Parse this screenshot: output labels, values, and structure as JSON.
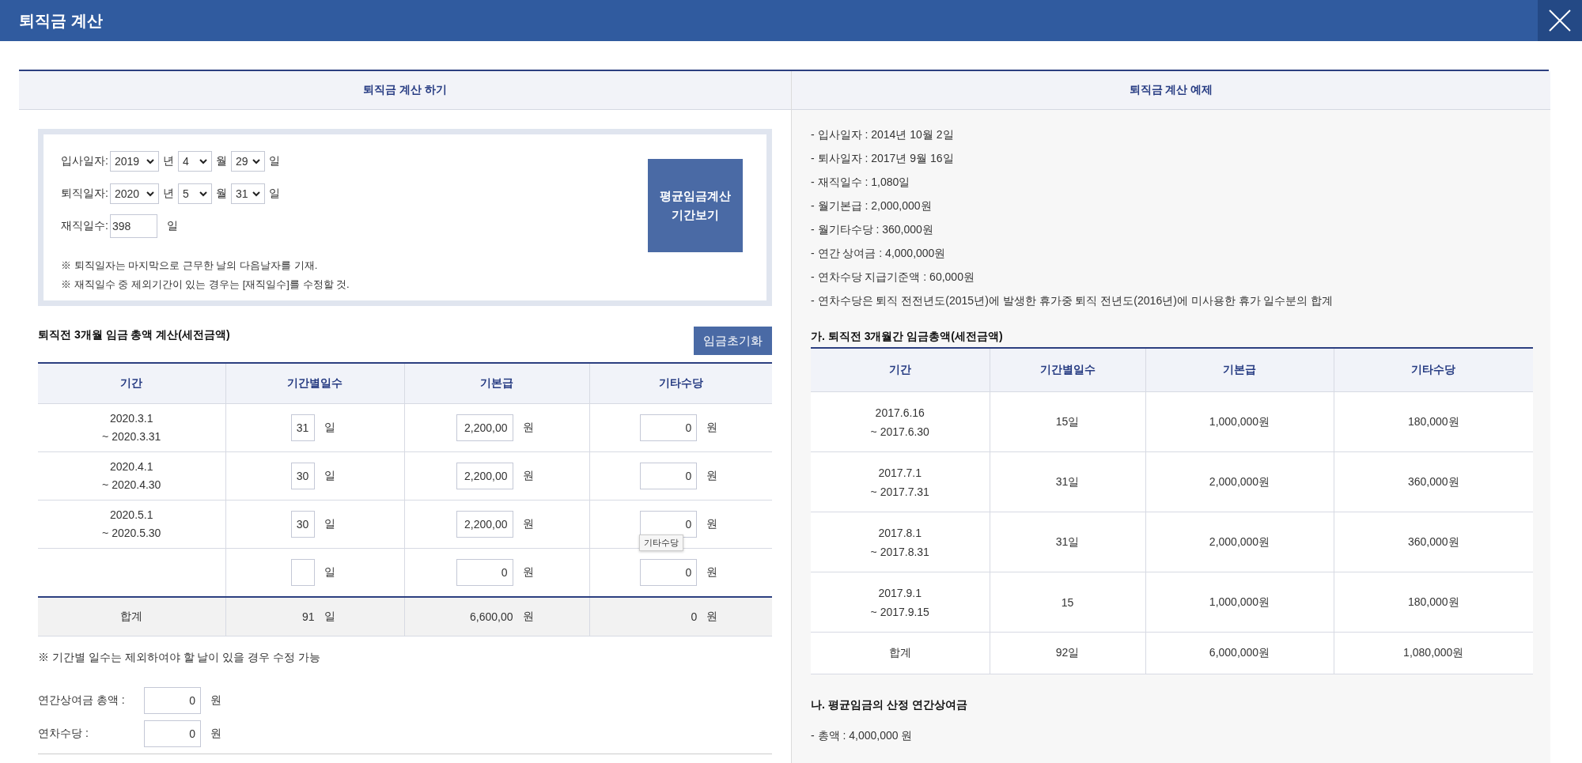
{
  "window": {
    "title": "퇴직금 계산"
  },
  "calculator": {
    "heading": "퇴직금 계산 하기",
    "date_rows": [
      {
        "label": "입사일자:",
        "year": "2019",
        "year_unit": "년",
        "month": "4",
        "month_unit": "월",
        "day": "29",
        "day_unit": "일"
      },
      {
        "label": "퇴직일자:",
        "year": "2020",
        "year_unit": "년",
        "month": "5",
        "month_unit": "월",
        "day": "31",
        "day_unit": "일"
      }
    ],
    "days_employed": {
      "label": "재직일수:",
      "value": "398",
      "unit": "일"
    },
    "notes": [
      "※ 퇴직일자는 마지막으로 근무한 날의 다음날자를 기재.",
      "※ 재직일수 중 제외기간이 있는 경우는 [재직일수]를 수정할 것."
    ],
    "period_button": "평균임금계산\n기간보기"
  },
  "wage_section": {
    "title": "퇴직전 3개월 임금 총액 계산(세전금액)",
    "reset_button": "임금초기화",
    "columns": [
      "기간",
      "기간별일수",
      "기본급",
      "기타수당"
    ],
    "rows": [
      {
        "period_start": "2020.3.1",
        "period_end": "~ 2020.3.31",
        "days": "31",
        "days_unit": "일",
        "base_pay": "2,200,00",
        "base_unit": "원",
        "other_pay": "0",
        "other_unit": "원"
      },
      {
        "period_start": "2020.4.1",
        "period_end": "~ 2020.4.30",
        "days": "30",
        "days_unit": "일",
        "base_pay": "2,200,00",
        "base_unit": "원",
        "other_pay": "0",
        "other_unit": "원"
      },
      {
        "period_start": "2020.5.1",
        "period_end": "~ 2020.5.30",
        "days": "30",
        "days_unit": "일",
        "base_pay": "2,200,00",
        "base_unit": "원",
        "other_pay": "0",
        "other_unit": "원",
        "tooltip": "기타수당"
      },
      {
        "days_unit": "일",
        "base_pay": "0",
        "base_unit": "원",
        "other_pay": "0",
        "other_unit": "원"
      }
    ],
    "total": {
      "label": "합계",
      "days": "91",
      "days_unit": "일",
      "base_pay": "6,600,00",
      "base_unit": "원",
      "other_pay": "0",
      "other_unit": "원"
    },
    "note": "※ 기간별 일수는 제외하여야 할 날이 있을 경우 수정 가능",
    "extras": [
      {
        "label": "연간상여금 총액 :",
        "value": "0",
        "unit": "원"
      },
      {
        "label": "연차수당 :",
        "value": "0",
        "unit": "원"
      }
    ]
  },
  "example": {
    "heading": "퇴직금 계산 예제",
    "facts": [
      "-  입사일자 : 2014년 10월 2일",
      "-  퇴사일자 : 2017년 9월 16일",
      "-  재직일수 : 1,080일",
      "-  월기본급 : 2,000,000원",
      "-  월기타수당 : 360,000원",
      "-  연간 상여금 : 4,000,000원",
      "-  연차수당 지급기준액 : 60,000원",
      "-  연차수당은 퇴직 전전년도(2015년)에 발생한 휴가중 퇴직 전년도(2016년)에 미사용한 휴가 일수분의 합계"
    ],
    "table_title": "가. 퇴직전 3개월간 임금총액(세전금액)",
    "columns": [
      "기간",
      "기간별일수",
      "기본급",
      "기타수당"
    ],
    "rows": [
      {
        "period_start": "2017.6.16",
        "period_end": "~ 2017.6.30",
        "days": "15일",
        "base_pay": "1,000,000원",
        "other_pay": "180,000원"
      },
      {
        "period_start": "2017.7.1",
        "period_end": "~ 2017.7.31",
        "days": "31일",
        "base_pay": "2,000,000원",
        "other_pay": "360,000원"
      },
      {
        "period_start": "2017.8.1",
        "period_end": "~ 2017.8.31",
        "days": "31일",
        "base_pay": "2,000,000원",
        "other_pay": "360,000원"
      },
      {
        "period_start": "2017.9.1",
        "period_end": "~ 2017.9.15",
        "days": "15",
        "base_pay": "1,000,000원",
        "other_pay": "180,000원"
      }
    ],
    "total": {
      "label": "합계",
      "days": "92일",
      "base_pay": "6,000,000원",
      "other_pay": "1,080,000원"
    },
    "bonus_title": "나. 평균임금의 산정 연간상여금",
    "bonus_lines": [
      "-  총액 : 4,000,000 원"
    ]
  }
}
